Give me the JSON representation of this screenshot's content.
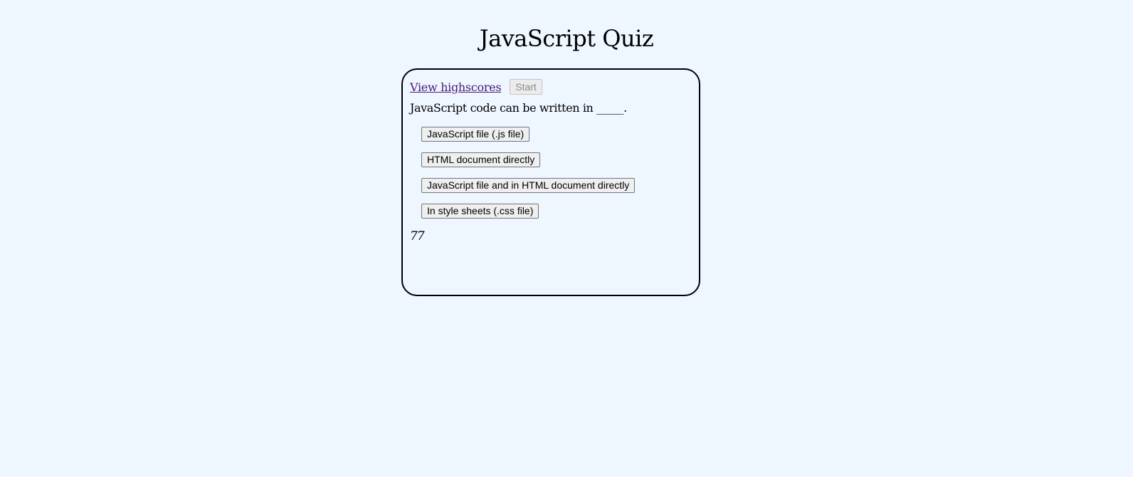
{
  "header": {
    "title": "JavaScript Quiz"
  },
  "quiz": {
    "highscores_label": "View highscores",
    "start_label": "Start",
    "question": "JavaScript code can be written in _____.",
    "answers": [
      "JavaScript file (.js file)",
      "HTML document directly",
      "JavaScript file and in HTML document directly",
      "In style sheets (.css file)"
    ],
    "timer": "77"
  },
  "colors": {
    "background": "#eef6ff",
    "link": "#4b1a7a",
    "border": "#000000"
  }
}
